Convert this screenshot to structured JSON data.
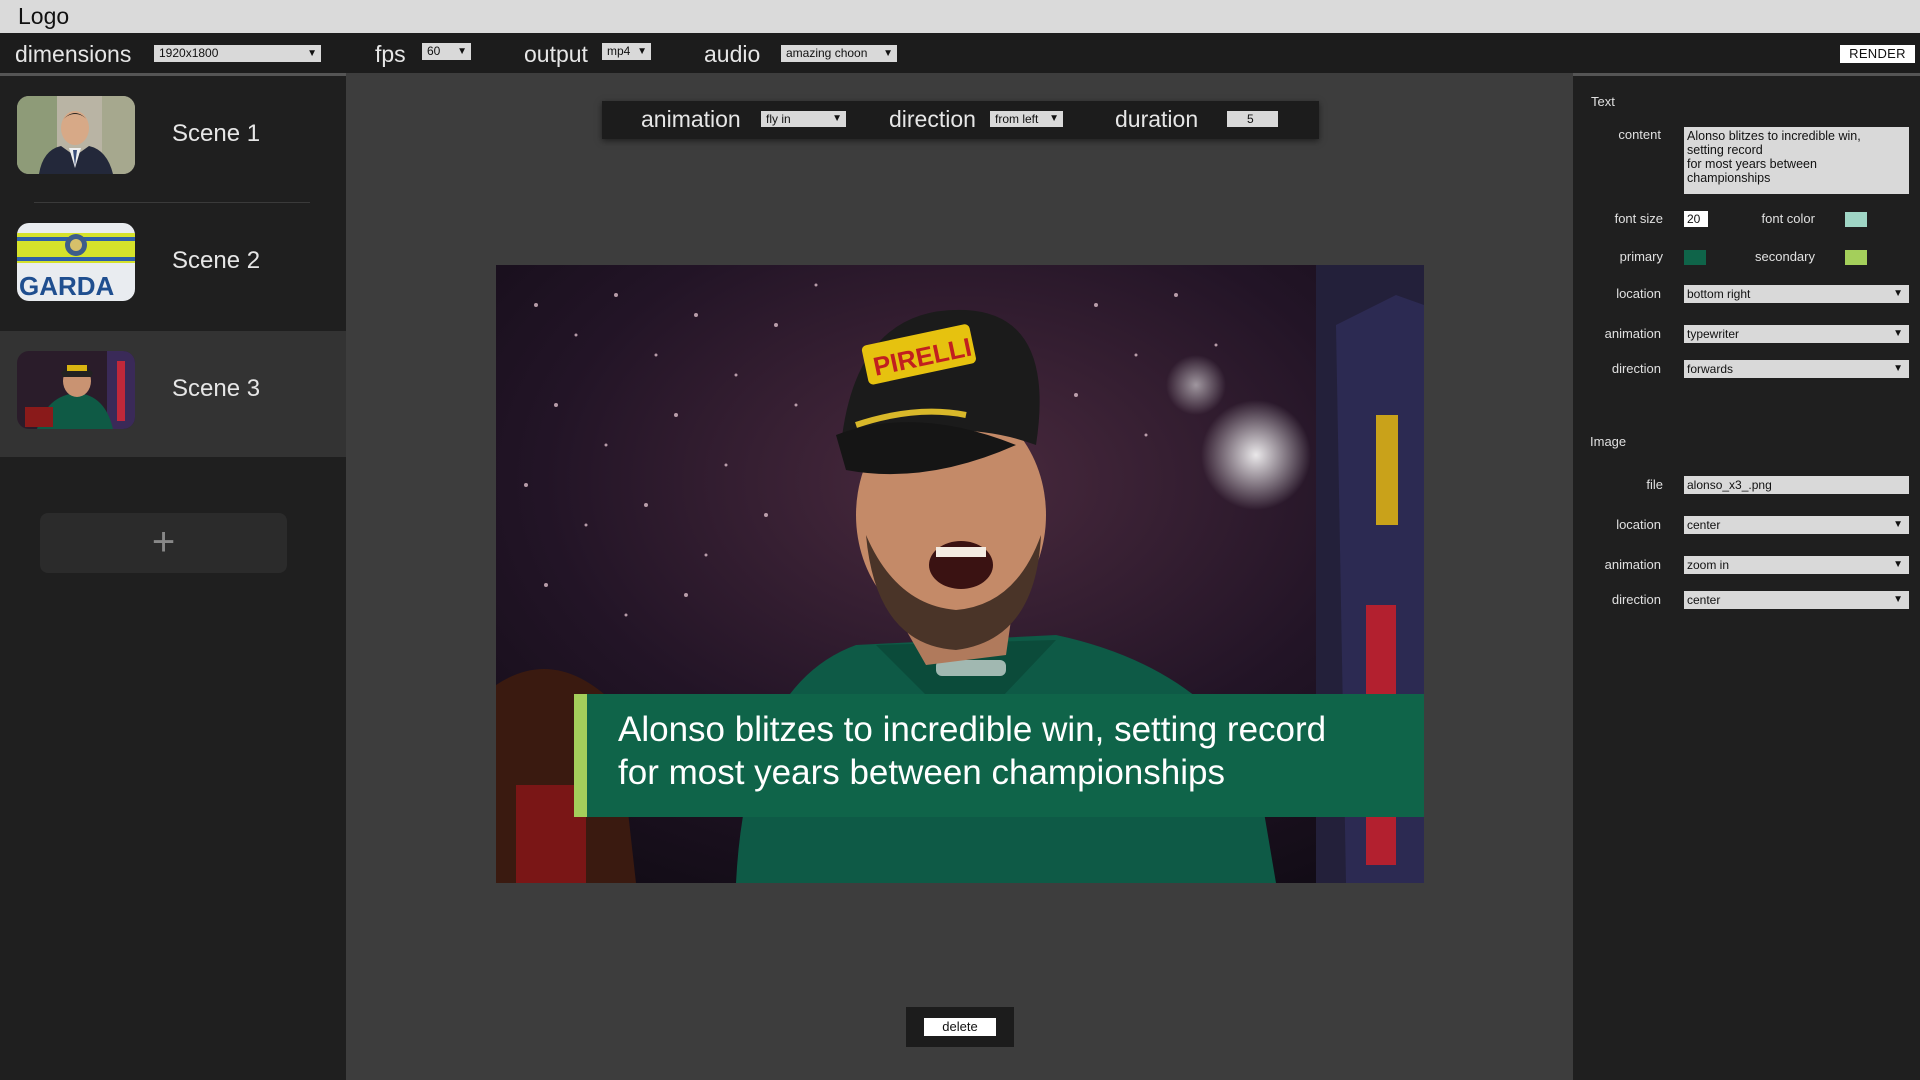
{
  "title_bar": {
    "logo": "Logo"
  },
  "toolbar": {
    "dimensions_label": "dimensions",
    "dimensions_value": "1920x1800",
    "fps_label": "fps",
    "fps_value": "60",
    "output_label": "output",
    "output_value": "mp4",
    "audio_label": "audio",
    "audio_value": "amazing choon",
    "render_label": "RENDER"
  },
  "scenes": [
    {
      "name": "Scene 1",
      "thumbnail": "man-in-suit"
    },
    {
      "name": "Scene 2",
      "thumbnail": "garda-livery"
    },
    {
      "name": "Scene 3",
      "thumbnail": "f1-driver-celebrating",
      "active": true
    }
  ],
  "add_scene_label": "+",
  "animation_bar": {
    "animation_label": "animation",
    "animation_value": "fly in",
    "direction_label": "direction",
    "direction_value": "from left",
    "duration_label": "duration",
    "duration_value": "5"
  },
  "preview": {
    "caption_line1": "Alonso blitzes to incredible win, setting record",
    "caption_line2": "for most years between championships"
  },
  "delete_label": "delete",
  "text_panel": {
    "title": "Text",
    "content_label": "content",
    "content_lines": [
      "Alonso blitzes to incredible win,",
      "setting record",
      "for most years between",
      "championships"
    ],
    "font_size_label": "font size",
    "font_size_value": "20",
    "font_color_label": "font color",
    "font_color": "#9fd5c5",
    "primary_label": "primary",
    "primary_color": "#0f6449",
    "secondary_label": "secondary",
    "secondary_color": "#a4cf5b",
    "location_label": "location",
    "location_value": "bottom right",
    "animation_label": "animation",
    "animation_value": "typewriter",
    "direction_label": "direction",
    "direction_value": "forwards"
  },
  "image_panel": {
    "title": "Image",
    "file_label": "file",
    "file_value": "alonso_x3_.png",
    "location_label": "location",
    "location_value": "center",
    "animation_label": "animation",
    "animation_value": "zoom in",
    "direction_label": "direction",
    "direction_value": "center"
  }
}
